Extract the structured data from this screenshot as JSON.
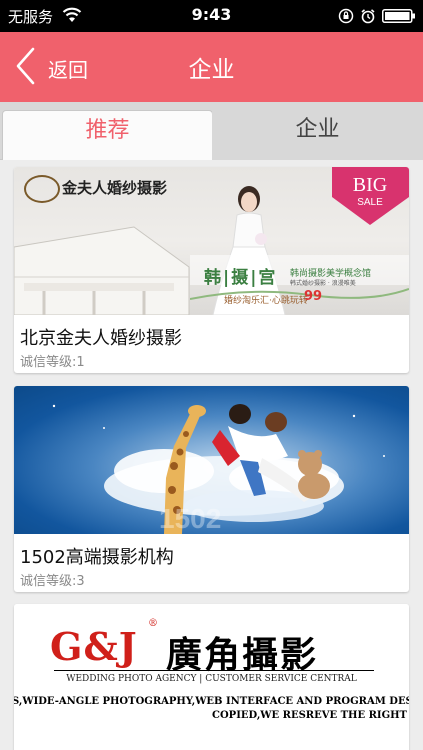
{
  "status_bar": {
    "carrier": "无服务",
    "time": "9:43"
  },
  "header": {
    "back_label": "返回",
    "title": "企业"
  },
  "tabs": [
    {
      "label": "推荐",
      "active": true
    },
    {
      "label": "企业",
      "active": false
    }
  ],
  "colors": {
    "accent": "#f0616c",
    "tab_bar": "#d8d8d8",
    "feed_bg": "#ededed"
  },
  "companies": [
    {
      "name": "北京金夫人婚纱摄影",
      "rating": "诚信等级:1",
      "image": {
        "logo_text": "金夫人婚纱摄影",
        "sale_badge_top": "BIG",
        "sale_badge_bottom": "SALE",
        "brand": "韩|摄|宫",
        "slogan": "韩尚摄影美学概念馆",
        "slogan_small": "韩式婚纱摄影 · 浪漫唯美",
        "promo": "婚纱淘乐汇·心跳玩转",
        "promo_number": "99"
      }
    },
    {
      "name": "1502高端摄影机构",
      "rating": "诚信等级:3",
      "image": {
        "watermark": "1502"
      }
    },
    {
      "name": "",
      "rating": "",
      "image": {
        "logo_latin": "G&J",
        "registered_mark": "®",
        "logo_cn": "廣角攝影",
        "agency_line": "WEDDING PHOTO AGENCY | CUSTOMER SERVICE CENTRAL",
        "copyright_line_1": "S,WIDE-ANGLE PHOTOGRAPHY,WEB INTERFACE AND PROGRAM DESIGN HAVE",
        "copyright_line_2": "COPIED,WE RESREVE THE RIGHT"
      }
    }
  ]
}
